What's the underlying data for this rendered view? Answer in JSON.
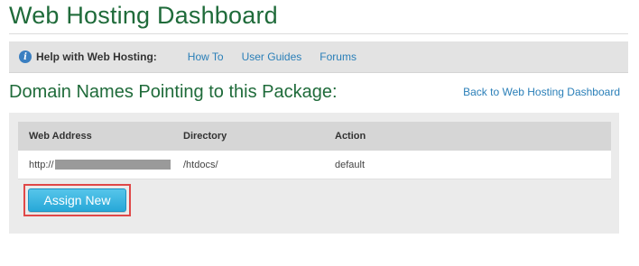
{
  "page": {
    "title": "Web Hosting Dashboard"
  },
  "help": {
    "label": "Help with Web Hosting:",
    "links": [
      "How To",
      "User Guides",
      "Forums"
    ]
  },
  "section": {
    "title": "Domain Names Pointing to this Package:",
    "back_link": "Back to Web Hosting Dashboard"
  },
  "table": {
    "headers": [
      "Web Address",
      "Directory",
      "Action"
    ],
    "rows": [
      {
        "web_address_prefix": "http://",
        "directory": "/htdocs/",
        "action": "default"
      }
    ]
  },
  "actions": {
    "assign_new": "Assign New"
  },
  "colors": {
    "title_green": "#1f6b3a",
    "link_blue": "#2a7fb8",
    "button_blue": "#27a8d8",
    "highlight_red": "#e04848"
  }
}
